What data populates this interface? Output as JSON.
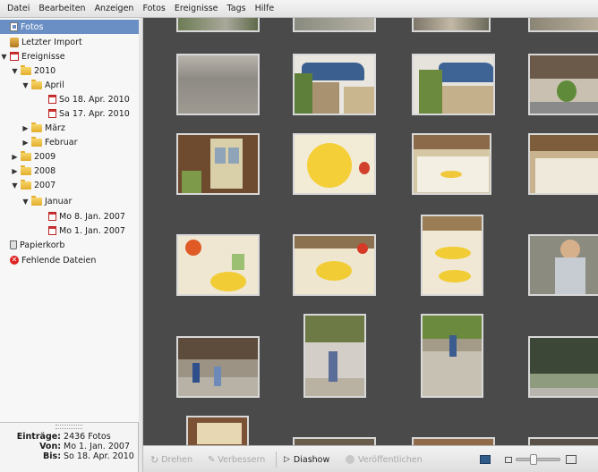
{
  "menubar": [
    "Datei",
    "Bearbeiten",
    "Anzeigen",
    "Fotos",
    "Ereignisse",
    "Tags",
    "Hilfe"
  ],
  "sidebar": {
    "items": [
      {
        "label": "Fotos",
        "icon": "photos-icon",
        "selected": true
      },
      {
        "label": "Letzter Import",
        "icon": "import-icon"
      },
      {
        "label": "Ereignisse",
        "icon": "events-icon",
        "expanded": true
      },
      {
        "label": "2010",
        "icon": "folder-icon",
        "expanded": true
      },
      {
        "label": "April",
        "icon": "folder-icon",
        "expanded": true
      },
      {
        "label": "So 18. Apr. 2010",
        "icon": "day-icon"
      },
      {
        "label": "Sa 17. Apr. 2010",
        "icon": "day-icon"
      },
      {
        "label": "März",
        "icon": "folder-icon",
        "expanded": false
      },
      {
        "label": "Februar",
        "icon": "folder-icon",
        "expanded": false
      },
      {
        "label": "2009",
        "icon": "folder-icon",
        "expanded": false
      },
      {
        "label": "2008",
        "icon": "folder-icon",
        "expanded": false
      },
      {
        "label": "2007",
        "icon": "folder-icon",
        "expanded": true
      },
      {
        "label": "Januar",
        "icon": "folder-icon",
        "expanded": true
      },
      {
        "label": "Mo 8. Jan. 2007",
        "icon": "day-icon"
      },
      {
        "label": "Mo 1. Jan. 2007",
        "icon": "day-icon"
      },
      {
        "label": "Papierkorb",
        "icon": "trash-icon"
      },
      {
        "label": "Fehlende Dateien",
        "icon": "missing-files-icon"
      }
    ]
  },
  "info": {
    "entries_label": "Einträge:",
    "entries_value": "2436 Fotos",
    "from_label": "Von:",
    "from_value": "Mo 1. Jan. 2007",
    "to_label": "Bis:",
    "to_value": "So 18. Apr. 2010"
  },
  "toolbar": {
    "rotate_label": "Drehen",
    "enhance_label": "Verbessern",
    "slideshow_label": "Diashow",
    "publish_label": "Veröffentlichen",
    "zoom_level": 0.35
  },
  "photos": [
    "garden-top-left",
    "garden-top",
    "garden-top",
    "garden-top",
    "gravel-yard",
    "blue-car-driveway",
    "blue-car-plants",
    "stone-steps",
    "front-door",
    "sun-tablecloth",
    "dining-hall",
    "dining-hall-2",
    "flower-table",
    "table-decoration",
    "long-table",
    "person-outdoors",
    "children-garden",
    "children-tree",
    "stone-path",
    "dark-garden",
    "living-room",
    "partial",
    "partial",
    "partial"
  ],
  "colors": {
    "selection": "#6a8fc4",
    "grid_background": "#4a4a4a",
    "sidebar_background": "#f7f7f7"
  }
}
